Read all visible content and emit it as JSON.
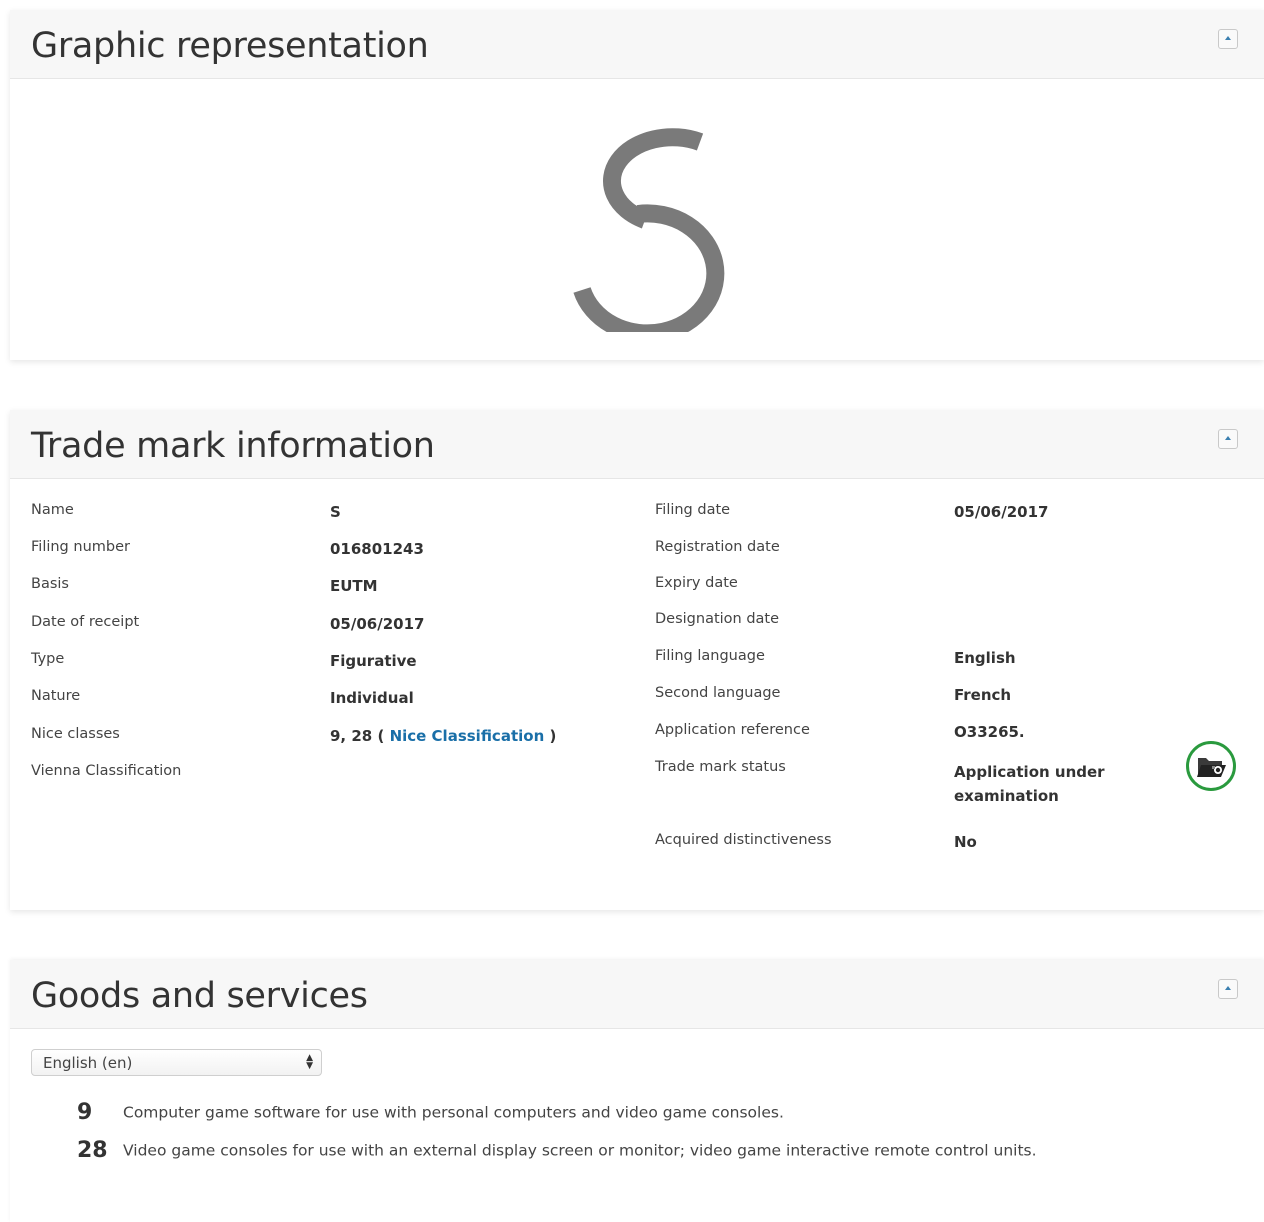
{
  "graphic": {
    "title": "Graphic representation",
    "logo_icon": "stylized-s-logo",
    "logo_color": "#7a7a7a"
  },
  "trademark": {
    "title": "Trade mark information",
    "left": [
      {
        "label": "Name",
        "value": "S"
      },
      {
        "label": "Filing number",
        "value": "016801243"
      },
      {
        "label": "Basis",
        "value": "EUTM"
      },
      {
        "label": "Date of receipt",
        "value": "05/06/2017"
      },
      {
        "label": "Type",
        "value": "Figurative"
      },
      {
        "label": "Nature",
        "value": "Individual"
      },
      {
        "label": "Nice classes",
        "value": "9, 28",
        "open": "(",
        "link": "Nice Classification",
        "close": ")"
      },
      {
        "label": "Vienna Classification",
        "value": ""
      }
    ],
    "right": [
      {
        "label": "Filing date",
        "value": "05/06/2017"
      },
      {
        "label": "Registration date",
        "value": ""
      },
      {
        "label": "Expiry date",
        "value": ""
      },
      {
        "label": "Designation date",
        "value": ""
      },
      {
        "label": "Filing language",
        "value": "English"
      },
      {
        "label": "Second language",
        "value": "French"
      },
      {
        "label": "Application reference",
        "value": "O33265."
      },
      {
        "label": "Trade mark status",
        "value_line1": "Application under",
        "value_line2": "examination"
      },
      {
        "label": "Acquired distinctiveness",
        "value": "No"
      }
    ],
    "status_icon": "open-folder-icon",
    "status_ring_color": "#2a9a3e",
    "link_color": "#1a6fa8"
  },
  "goods": {
    "title": "Goods and services",
    "language_select": "English (en)",
    "items": [
      {
        "class": "9",
        "text": "Computer game software for use with personal computers and video game consoles."
      },
      {
        "class": "28",
        "text": "Video game consoles for use with an external display screen or monitor; video game interactive remote control units."
      }
    ]
  },
  "collapse_icon": "collapse-up-icon"
}
